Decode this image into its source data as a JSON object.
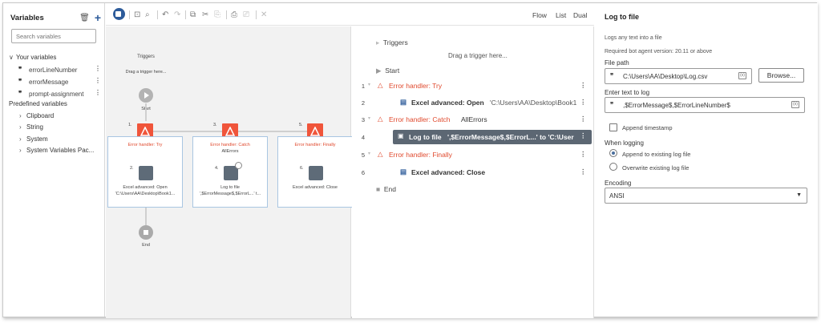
{
  "variables_panel": {
    "title": "Variables",
    "search_placeholder": "Search variables",
    "your_variables_label": "Your variables",
    "your_variables": [
      "errorLineNumber",
      "errorMessage",
      "prompt-assignment"
    ],
    "predefined_label": "Predefined variables",
    "predefined": [
      "Clipboard",
      "String",
      "System",
      "System Variables Pac..."
    ]
  },
  "view_modes": [
    "Flow",
    "List",
    "Dual"
  ],
  "flow_canvas": {
    "triggers_label": "Triggers",
    "drag_trigger_text": "Drag a trigger here...",
    "start_label": "Start",
    "end_label": "End",
    "blocks": [
      {
        "number": "1.",
        "title": "Error handler: Try",
        "subtitle": "",
        "child_number": "2.",
        "child_line1": "Excel advanced: Open",
        "child_line2": "'C:\\Users\\AA\\Desktop\\Book1..."
      },
      {
        "number": "3.",
        "title": "Error handler: Catch",
        "subtitle": "AllErrors",
        "child_number": "4.",
        "child_line1": "Log to file",
        "child_line2": "',$ErrorMessage$,$ErrorL...' t..."
      },
      {
        "number": "5.",
        "title": "Error handler: Finally",
        "subtitle": "",
        "child_number": "6.",
        "child_line1": "Excel advanced: Close",
        "child_line2": ""
      }
    ]
  },
  "list_view": {
    "triggers_label": "Triggers",
    "drag_trigger_text": "Drag a trigger here...",
    "start_label": "Start",
    "end_label": "End",
    "rows": [
      {
        "num": "1",
        "kind": "handler",
        "text": "Error handler: Try",
        "extra": ""
      },
      {
        "num": "2",
        "kind": "excel",
        "text": "Excel advanced: Open",
        "extra": "'C:\\Users\\AA\\Desktop\\Book1.xl..."
      },
      {
        "num": "3",
        "kind": "handler",
        "text": "Error handler: Catch",
        "extra": "AllErrors"
      },
      {
        "num": "4",
        "kind": "log",
        "text": "Log to file",
        "extra": "',$ErrorMessage$,$ErrorL...' to 'C:\\Users\\A..."
      },
      {
        "num": "5",
        "kind": "handler",
        "text": "Error handler: Finally",
        "extra": ""
      },
      {
        "num": "6",
        "kind": "excel",
        "text": "Excel advanced: Close",
        "extra": ""
      }
    ]
  },
  "properties": {
    "title": "Log to file",
    "description": "Logs any text into a file",
    "requirement": "Required bot agent version: 20.11 or above",
    "file_path_label": "File path",
    "file_path_value": "C:\\Users\\AA\\Desktop\\Log.csv",
    "browse_label": "Browse...",
    "text_label": "Enter text to log",
    "text_value": ",$ErrorMessage$,$ErrorLineNumber$",
    "append_timestamp_label": "Append timestamp",
    "when_logging_label": "When logging",
    "append_option": "Append to existing log file",
    "overwrite_option": "Overwrite existing log file",
    "encoding_label": "Encoding",
    "encoding_value": "ANSI",
    "variable_icon_text": "(x)"
  },
  "colors": {
    "accent": "#2d5b9a",
    "error_handler": "#f0553b",
    "selected_row": "#5c6773"
  }
}
